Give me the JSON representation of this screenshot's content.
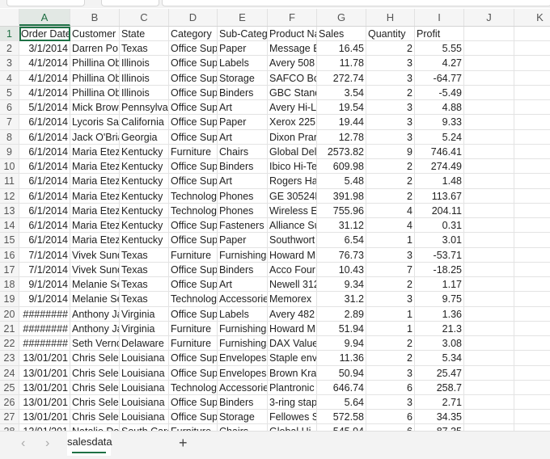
{
  "columns": [
    "A",
    "B",
    "C",
    "D",
    "E",
    "F",
    "G",
    "H",
    "I",
    "J",
    "K"
  ],
  "active_cell": "A1",
  "rows": [
    [
      "Order Date",
      "Customer",
      "State",
      "Category",
      "Sub-Categ",
      "Product Na",
      "Sales",
      "Quantity",
      "Profit"
    ],
    [
      "3/1/2014",
      "Darren Po",
      "Texas",
      "Office Sup",
      "Paper",
      "Message B",
      "16.45",
      "2",
      "5.55"
    ],
    [
      "4/1/2014",
      "Phillina Ob",
      "Illinois",
      "Office Sup",
      "Labels",
      "Avery 508",
      "11.78",
      "3",
      "4.27"
    ],
    [
      "4/1/2014",
      "Phillina Ob",
      "Illinois",
      "Office Sup",
      "Storage",
      "SAFCO Bol",
      "272.74",
      "3",
      "-64.77"
    ],
    [
      "4/1/2014",
      "Phillina Ob",
      "Illinois",
      "Office Sup",
      "Binders",
      "GBC Stand",
      "3.54",
      "2",
      "-5.49"
    ],
    [
      "5/1/2014",
      "Mick Brow",
      "Pennsylvan",
      "Office Sup",
      "Art",
      "Avery Hi-Li",
      "19.54",
      "3",
      "4.88"
    ],
    [
      "6/1/2014",
      "Lycoris Sa",
      "California",
      "Office Sup",
      "Paper",
      "Xerox 225",
      "19.44",
      "3",
      "9.33"
    ],
    [
      "6/1/2014",
      "Jack O'Bria",
      "Georgia",
      "Office Sup",
      "Art",
      "Dixon Prar",
      "12.78",
      "3",
      "5.24"
    ],
    [
      "6/1/2014",
      "Maria Etez",
      "Kentucky",
      "Furniture",
      "Chairs",
      "Global Del",
      "2573.82",
      "9",
      "746.41"
    ],
    [
      "6/1/2014",
      "Maria Etez",
      "Kentucky",
      "Office Sup",
      "Binders",
      "Ibico Hi-Te",
      "609.98",
      "2",
      "274.49"
    ],
    [
      "6/1/2014",
      "Maria Etez",
      "Kentucky",
      "Office Sup",
      "Art",
      "Rogers Ha",
      "5.48",
      "2",
      "1.48"
    ],
    [
      "6/1/2014",
      "Maria Etez",
      "Kentucky",
      "Technolog",
      "Phones",
      "GE 30524E",
      "391.98",
      "2",
      "113.67"
    ],
    [
      "6/1/2014",
      "Maria Etez",
      "Kentucky",
      "Technolog",
      "Phones",
      "Wireless E",
      "755.96",
      "4",
      "204.11"
    ],
    [
      "6/1/2014",
      "Maria Etez",
      "Kentucky",
      "Office Sup",
      "Fasteners",
      "Alliance Su",
      "31.12",
      "4",
      "0.31"
    ],
    [
      "6/1/2014",
      "Maria Etez",
      "Kentucky",
      "Office Sup",
      "Paper",
      "Southwort",
      "6.54",
      "1",
      "3.01"
    ],
    [
      "7/1/2014",
      "Vivek Sund",
      "Texas",
      "Furniture",
      "Furnishings",
      "Howard M",
      "76.73",
      "3",
      "-53.71"
    ],
    [
      "7/1/2014",
      "Vivek Sund",
      "Texas",
      "Office Sup",
      "Binders",
      "Acco Four",
      "10.43",
      "7",
      "-18.25"
    ],
    [
      "9/1/2014",
      "Melanie Se",
      "Texas",
      "Office Sup",
      "Art",
      "Newell 312",
      "9.34",
      "2",
      "1.17"
    ],
    [
      "9/1/2014",
      "Melanie Se",
      "Texas",
      "Technolog",
      "Accessorie",
      "Memorex",
      "31.2",
      "3",
      "9.75"
    ],
    [
      "########",
      "Anthony Ja",
      "Virginia",
      "Office Sup",
      "Labels",
      "Avery 482",
      "2.89",
      "1",
      "1.36"
    ],
    [
      "########",
      "Anthony Ja",
      "Virginia",
      "Furniture",
      "Furnishings",
      "Howard M",
      "51.94",
      "1",
      "21.3"
    ],
    [
      "########",
      "Seth Vernc",
      "Delaware",
      "Furniture",
      "Furnishings",
      "DAX Value",
      "9.94",
      "2",
      "3.08"
    ],
    [
      "13/01/201",
      "Chris Seles",
      "Louisiana",
      "Office Sup",
      "Envelopes",
      "Staple env",
      "11.36",
      "2",
      "5.34"
    ],
    [
      "13/01/201",
      "Chris Seles",
      "Louisiana",
      "Office Sup",
      "Envelopes",
      "Brown Kra",
      "50.94",
      "3",
      "25.47"
    ],
    [
      "13/01/201",
      "Chris Seles",
      "Louisiana",
      "Technolog",
      "Accessorie",
      "Plantronic",
      "646.74",
      "6",
      "258.7"
    ],
    [
      "13/01/201",
      "Chris Seles",
      "Louisiana",
      "Office Sup",
      "Binders",
      "3-ring stap",
      "5.64",
      "3",
      "2.71"
    ],
    [
      "13/01/201",
      "Chris Seles",
      "Louisiana",
      "Office Sup",
      "Storage",
      "Fellowes S",
      "572.58",
      "6",
      "34.35"
    ],
    [
      "13/01/201",
      "Natalie De",
      "South Caro",
      "Furniture",
      "Chairs",
      "Global Hi",
      "545.94",
      "6",
      "87.35"
    ]
  ],
  "sheet_tabs": {
    "prev": "‹",
    "next": "›",
    "active": "salesdata",
    "add": "+"
  }
}
